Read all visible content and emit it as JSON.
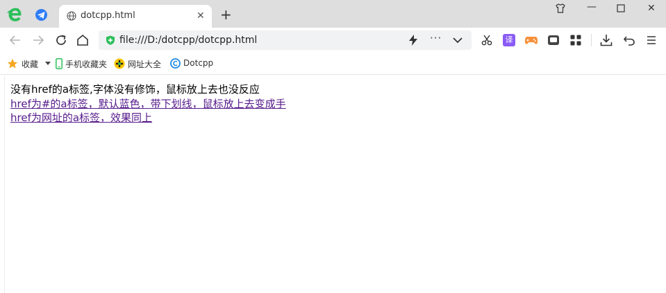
{
  "tab": {
    "title": "dotcpp.html"
  },
  "address": {
    "url": "file:///D:/dotcpp/dotcpp.html"
  },
  "bookmarks": [
    {
      "label": "收藏",
      "icon": "star-icon"
    },
    {
      "label": "手机收藏夹",
      "icon": "phone-icon"
    },
    {
      "label": "网址大全",
      "icon": "site-icon"
    },
    {
      "label": "Dotcpp",
      "icon": "dotcpp-icon"
    }
  ],
  "toolbar": {
    "translate_label": "译"
  },
  "content": {
    "line1": "没有href的a标签,字体没有修饰，鼠标放上去也没反应",
    "line2": "href为#的a标签，默认蓝色，带下划线，鼠标放上去变成手",
    "line3": "href为网址的a标签，效果同上"
  },
  "colors": {
    "tabstrip": "#dedede",
    "accent_green": "#2dbf5b",
    "link_visited": "#551a8b",
    "telegram_blue": "#2f7df6",
    "translate_purple": "#8a5cf6",
    "game_orange": "#f7913b"
  }
}
